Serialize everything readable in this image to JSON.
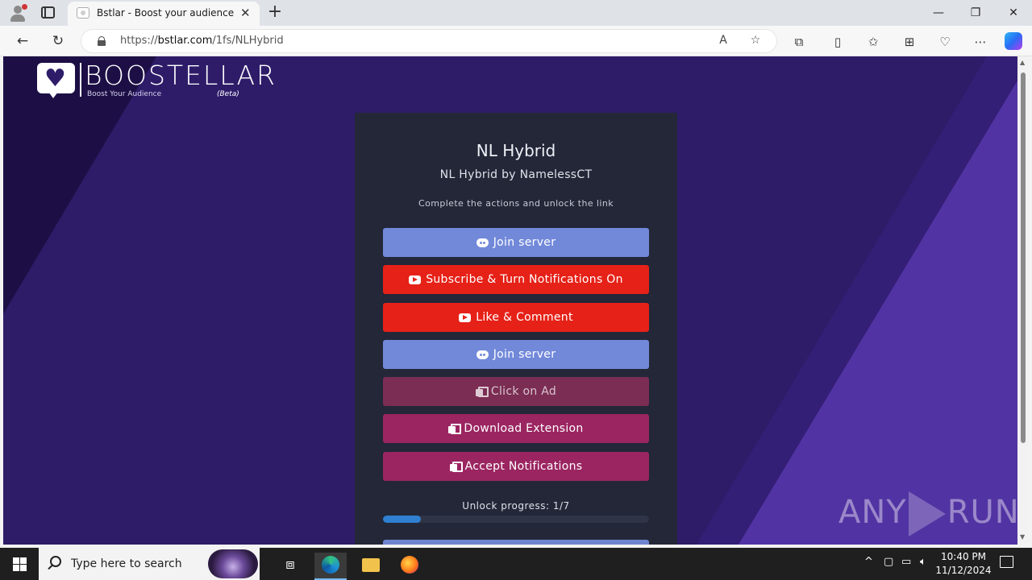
{
  "browser": {
    "tab_title": "Bstlar - Boost your audience",
    "url_prefix": "https://",
    "url_host": "bstlar.com",
    "url_path": "/1fs/NLHybrid",
    "new_tab_symbol": "+",
    "tab_close_symbol": "✕"
  },
  "page": {
    "logo": {
      "name": "BOOSTELLAR",
      "tagline": "Boost Your Audience",
      "beta": "(Beta)"
    },
    "card": {
      "title": "NL Hybrid",
      "subtitle": "NL Hybrid by NamelessCT",
      "description": "Complete the actions and unlock the link",
      "actions": [
        {
          "label": "Join server",
          "icon": "discord-icon",
          "color": "#7289da"
        },
        {
          "label": "Subscribe & Turn Notifications On",
          "icon": "youtube-icon",
          "color": "#e62117"
        },
        {
          "label": "Like & Comment",
          "icon": "youtube-icon",
          "color": "#e62117"
        },
        {
          "label": "Join server",
          "icon": "discord-icon",
          "color": "#7289da"
        },
        {
          "label": "Click on Ad",
          "icon": "copy-icon",
          "color": "#7b2d53",
          "state": "disabled"
        },
        {
          "label": "Download Extension",
          "icon": "copy-icon",
          "color": "#9b2561"
        },
        {
          "label": "Accept Notifications",
          "icon": "copy-icon",
          "color": "#9b2561"
        }
      ],
      "progress_label": "Unlock progress: 1/7",
      "progress_fraction": 0.1429
    },
    "watermark": {
      "left": "ANY",
      "right": "RUN"
    }
  },
  "taskbar": {
    "search_placeholder": "Type here to search",
    "time": "10:40 PM",
    "date": "11/12/2024"
  }
}
